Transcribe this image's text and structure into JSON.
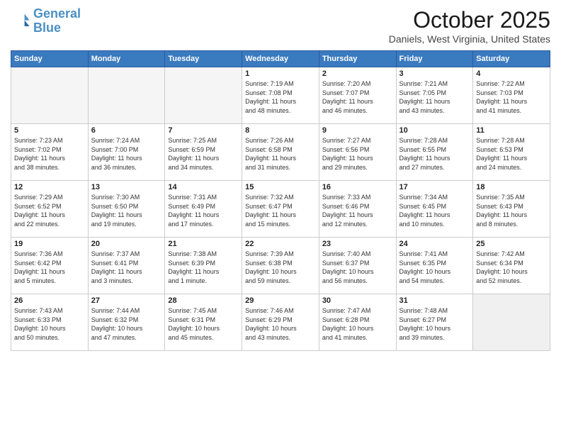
{
  "logo": {
    "line1": "General",
    "line2": "Blue"
  },
  "title": "October 2025",
  "location": "Daniels, West Virginia, United States",
  "days_of_week": [
    "Sunday",
    "Monday",
    "Tuesday",
    "Wednesday",
    "Thursday",
    "Friday",
    "Saturday"
  ],
  "weeks": [
    [
      {
        "num": "",
        "info": ""
      },
      {
        "num": "",
        "info": ""
      },
      {
        "num": "",
        "info": ""
      },
      {
        "num": "1",
        "info": "Sunrise: 7:19 AM\nSunset: 7:08 PM\nDaylight: 11 hours\nand 48 minutes."
      },
      {
        "num": "2",
        "info": "Sunrise: 7:20 AM\nSunset: 7:07 PM\nDaylight: 11 hours\nand 46 minutes."
      },
      {
        "num": "3",
        "info": "Sunrise: 7:21 AM\nSunset: 7:05 PM\nDaylight: 11 hours\nand 43 minutes."
      },
      {
        "num": "4",
        "info": "Sunrise: 7:22 AM\nSunset: 7:03 PM\nDaylight: 11 hours\nand 41 minutes."
      }
    ],
    [
      {
        "num": "5",
        "info": "Sunrise: 7:23 AM\nSunset: 7:02 PM\nDaylight: 11 hours\nand 38 minutes."
      },
      {
        "num": "6",
        "info": "Sunrise: 7:24 AM\nSunset: 7:00 PM\nDaylight: 11 hours\nand 36 minutes."
      },
      {
        "num": "7",
        "info": "Sunrise: 7:25 AM\nSunset: 6:59 PM\nDaylight: 11 hours\nand 34 minutes."
      },
      {
        "num": "8",
        "info": "Sunrise: 7:26 AM\nSunset: 6:58 PM\nDaylight: 11 hours\nand 31 minutes."
      },
      {
        "num": "9",
        "info": "Sunrise: 7:27 AM\nSunset: 6:56 PM\nDaylight: 11 hours\nand 29 minutes."
      },
      {
        "num": "10",
        "info": "Sunrise: 7:28 AM\nSunset: 6:55 PM\nDaylight: 11 hours\nand 27 minutes."
      },
      {
        "num": "11",
        "info": "Sunrise: 7:28 AM\nSunset: 6:53 PM\nDaylight: 11 hours\nand 24 minutes."
      }
    ],
    [
      {
        "num": "12",
        "info": "Sunrise: 7:29 AM\nSunset: 6:52 PM\nDaylight: 11 hours\nand 22 minutes."
      },
      {
        "num": "13",
        "info": "Sunrise: 7:30 AM\nSunset: 6:50 PM\nDaylight: 11 hours\nand 19 minutes."
      },
      {
        "num": "14",
        "info": "Sunrise: 7:31 AM\nSunset: 6:49 PM\nDaylight: 11 hours\nand 17 minutes."
      },
      {
        "num": "15",
        "info": "Sunrise: 7:32 AM\nSunset: 6:47 PM\nDaylight: 11 hours\nand 15 minutes."
      },
      {
        "num": "16",
        "info": "Sunrise: 7:33 AM\nSunset: 6:46 PM\nDaylight: 11 hours\nand 12 minutes."
      },
      {
        "num": "17",
        "info": "Sunrise: 7:34 AM\nSunset: 6:45 PM\nDaylight: 11 hours\nand 10 minutes."
      },
      {
        "num": "18",
        "info": "Sunrise: 7:35 AM\nSunset: 6:43 PM\nDaylight: 11 hours\nand 8 minutes."
      }
    ],
    [
      {
        "num": "19",
        "info": "Sunrise: 7:36 AM\nSunset: 6:42 PM\nDaylight: 11 hours\nand 5 minutes."
      },
      {
        "num": "20",
        "info": "Sunrise: 7:37 AM\nSunset: 6:41 PM\nDaylight: 11 hours\nand 3 minutes."
      },
      {
        "num": "21",
        "info": "Sunrise: 7:38 AM\nSunset: 6:39 PM\nDaylight: 11 hours\nand 1 minute."
      },
      {
        "num": "22",
        "info": "Sunrise: 7:39 AM\nSunset: 6:38 PM\nDaylight: 10 hours\nand 59 minutes."
      },
      {
        "num": "23",
        "info": "Sunrise: 7:40 AM\nSunset: 6:37 PM\nDaylight: 10 hours\nand 56 minutes."
      },
      {
        "num": "24",
        "info": "Sunrise: 7:41 AM\nSunset: 6:35 PM\nDaylight: 10 hours\nand 54 minutes."
      },
      {
        "num": "25",
        "info": "Sunrise: 7:42 AM\nSunset: 6:34 PM\nDaylight: 10 hours\nand 52 minutes."
      }
    ],
    [
      {
        "num": "26",
        "info": "Sunrise: 7:43 AM\nSunset: 6:33 PM\nDaylight: 10 hours\nand 50 minutes."
      },
      {
        "num": "27",
        "info": "Sunrise: 7:44 AM\nSunset: 6:32 PM\nDaylight: 10 hours\nand 47 minutes."
      },
      {
        "num": "28",
        "info": "Sunrise: 7:45 AM\nSunset: 6:31 PM\nDaylight: 10 hours\nand 45 minutes."
      },
      {
        "num": "29",
        "info": "Sunrise: 7:46 AM\nSunset: 6:29 PM\nDaylight: 10 hours\nand 43 minutes."
      },
      {
        "num": "30",
        "info": "Sunrise: 7:47 AM\nSunset: 6:28 PM\nDaylight: 10 hours\nand 41 minutes."
      },
      {
        "num": "31",
        "info": "Sunrise: 7:48 AM\nSunset: 6:27 PM\nDaylight: 10 hours\nand 39 minutes."
      },
      {
        "num": "",
        "info": ""
      }
    ]
  ]
}
